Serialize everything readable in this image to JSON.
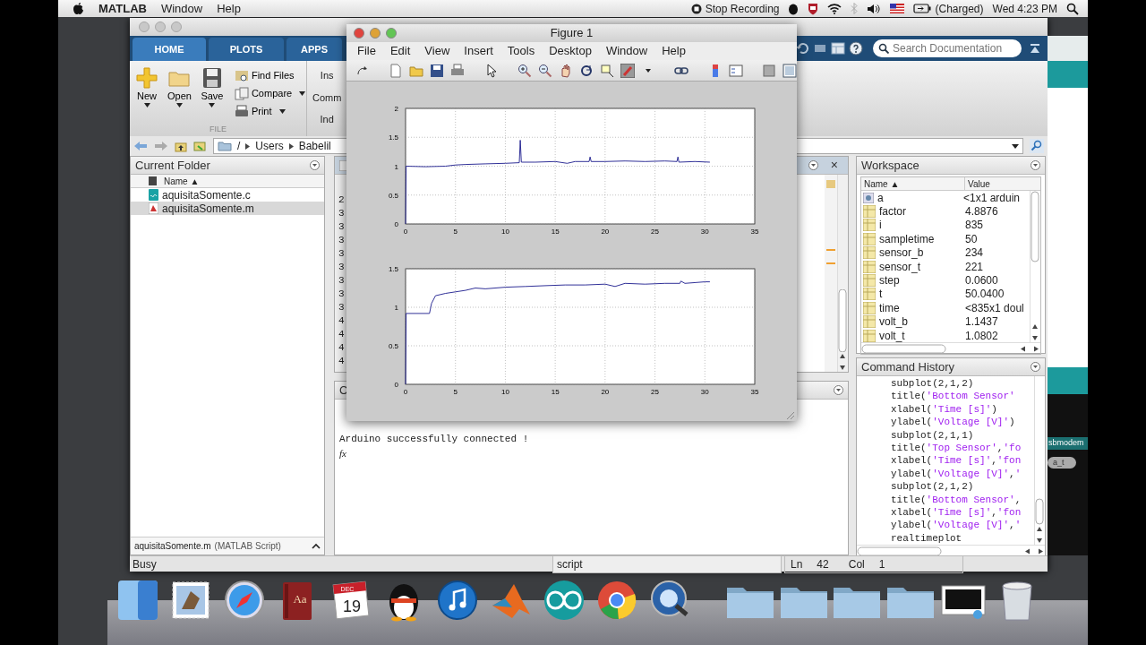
{
  "menubar": {
    "app": "MATLAB",
    "menus": [
      "Window",
      "Help"
    ],
    "recording": "Stop Recording",
    "battery": "(Charged)",
    "clock": "Wed 4:23 PM"
  },
  "matlab": {
    "tabs": [
      {
        "label": "HOME",
        "selected": true
      },
      {
        "label": "PLOTS",
        "selected": false
      },
      {
        "label": "APPS",
        "selected": false
      }
    ],
    "search": {
      "placeholder": "Search Documentation"
    },
    "file_section": {
      "label": "FILE",
      "buttons": [
        {
          "label": "New",
          "kind": "new"
        },
        {
          "label": "Open",
          "kind": "open"
        },
        {
          "label": "Save",
          "kind": "save"
        }
      ],
      "small_buttons": [
        {
          "label": "Find Files",
          "kind": "find",
          "dropdown": false
        },
        {
          "label": "Compare",
          "kind": "compare",
          "dropdown": true
        },
        {
          "label": "Print",
          "kind": "print",
          "dropdown": true
        }
      ]
    },
    "partial_labels": [
      "Ins",
      "Comm",
      "Ind"
    ],
    "path": [
      "/",
      "Users",
      "Babelil"
    ],
    "current_folder": {
      "title": "Current Folder",
      "column": "Name ▲",
      "files": [
        {
          "name": "aquisitaSomente.c",
          "kind": "c",
          "selected": false
        },
        {
          "name": "aquisitaSomente.m",
          "kind": "m",
          "selected": true
        }
      ],
      "details_name": "aquisitaSomente.m",
      "details_type": "(MATLAB Script)"
    },
    "editor": {
      "close": "×",
      "line_numbers": [
        "2",
        "3",
        "3",
        "3",
        "3",
        "3",
        "3",
        "3",
        "3",
        "4",
        "4",
        "4",
        "4"
      ]
    },
    "command_window": {
      "title": "C",
      "output": "Arduino successfully connected !",
      "prompt": "fx"
    },
    "workspace": {
      "title": "Workspace",
      "columns": [
        "Name ▲",
        "Value"
      ],
      "rows": [
        {
          "name": "a",
          "value": "<1x1 arduin",
          "kind": "object"
        },
        {
          "name": "factor",
          "value": "4.8876",
          "kind": "numeric"
        },
        {
          "name": "i",
          "value": "835",
          "kind": "numeric"
        },
        {
          "name": "sampletime",
          "value": "50",
          "kind": "numeric"
        },
        {
          "name": "sensor_b",
          "value": "234",
          "kind": "numeric"
        },
        {
          "name": "sensor_t",
          "value": "221",
          "kind": "numeric"
        },
        {
          "name": "step",
          "value": "0.0600",
          "kind": "numeric"
        },
        {
          "name": "t",
          "value": "50.0400",
          "kind": "numeric"
        },
        {
          "name": "time",
          "value": "<835x1 doul",
          "kind": "numeric"
        },
        {
          "name": "volt_b",
          "value": "1.1437",
          "kind": "numeric"
        },
        {
          "name": "volt_t",
          "value": "1.0802",
          "kind": "numeric"
        }
      ]
    },
    "command_history": {
      "title": "Command History",
      "lines": [
        "subplot(2,1,2)",
        "title('Bottom Sensor'",
        "xlabel('Time [s]')",
        "ylabel('Voltage [V]')",
        "subplot(2,1,1)",
        "title('Top Sensor','fo",
        "xlabel('Time [s]','fon",
        "ylabel('Voltage [V]','",
        "subplot(2,1,2)",
        "title('Bottom Sensor',",
        "xlabel('Time [s]','fon",
        "ylabel('Voltage [V]','",
        "realtimeplot"
      ]
    },
    "status": {
      "state": "Busy",
      "file_type": "script",
      "ln_label": "Ln",
      "ln": "42",
      "col_label": "Col",
      "col": "1"
    }
  },
  "arduino_window": {
    "port": "sbmodem",
    "chip": "a_t"
  },
  "figure": {
    "title": "Figure 1",
    "menus": [
      "File",
      "Edit",
      "View",
      "Insert",
      "Tools",
      "Desktop",
      "Window",
      "Help"
    ],
    "charts": [
      {
        "chart_data": {
          "type": "line",
          "x": [
            0,
            0.05,
            2,
            4,
            5,
            6,
            8,
            10,
            11.4,
            11.5,
            11.6,
            13,
            15,
            16.2,
            17,
            18.4,
            18.5,
            18.6,
            20,
            22,
            24,
            26,
            27.2,
            27.3,
            27.4,
            29,
            30.5
          ],
          "xlim": [
            0,
            35
          ],
          "ylim": [
            0,
            2
          ],
          "xticks": [
            0,
            5,
            10,
            15,
            20,
            25,
            30,
            35
          ],
          "yticks": [
            0,
            0.5,
            1,
            1.5,
            2
          ],
          "grid": true,
          "series": [
            {
              "color": "#1a1a8c",
              "values": [
                0,
                1.0,
                0.99,
                1.0,
                1.02,
                1.03,
                1.04,
                1.05,
                1.06,
                1.45,
                1.07,
                1.07,
                1.08,
                1.05,
                1.08,
                1.08,
                1.16,
                1.08,
                1.08,
                1.09,
                1.08,
                1.09,
                1.08,
                1.16,
                1.07,
                1.08,
                1.07
              ]
            }
          ]
        }
      },
      {
        "chart_data": {
          "type": "line",
          "x": [
            0,
            0.05,
            2.4,
            2.6,
            3,
            4,
            5,
            6,
            7,
            8,
            10,
            12,
            14,
            16,
            18,
            20,
            21,
            22,
            24,
            26,
            27.5,
            27.6,
            28,
            30,
            30.5
          ],
          "xlim": [
            0,
            35
          ],
          "ylim": [
            0,
            1.5
          ],
          "xticks": [
            0,
            5,
            10,
            15,
            20,
            25,
            30,
            35
          ],
          "yticks": [
            0,
            0.5,
            1,
            1.5
          ],
          "grid": true,
          "series": [
            {
              "color": "#1a1a8c",
              "values": [
                0,
                0.92,
                0.92,
                1.05,
                1.15,
                1.18,
                1.2,
                1.22,
                1.25,
                1.24,
                1.26,
                1.27,
                1.28,
                1.29,
                1.29,
                1.3,
                1.27,
                1.31,
                1.3,
                1.31,
                1.31,
                1.34,
                1.31,
                1.33,
                1.33
              ]
            }
          ]
        }
      }
    ]
  },
  "dock": {
    "items": [
      {
        "kind": "finder"
      },
      {
        "kind": "mail"
      },
      {
        "kind": "safari"
      },
      {
        "kind": "dictionary",
        "label": "Aa"
      },
      {
        "kind": "calendar",
        "month": "DEC",
        "day": "19"
      },
      {
        "kind": "penguin"
      },
      {
        "kind": "itunes"
      },
      {
        "kind": "matlab"
      },
      {
        "kind": "arduino"
      },
      {
        "kind": "chrome"
      },
      {
        "kind": "quicktime"
      },
      {
        "kind": "separator"
      },
      {
        "kind": "folder"
      },
      {
        "kind": "folder"
      },
      {
        "kind": "folder"
      },
      {
        "kind": "folder"
      },
      {
        "kind": "monitor"
      },
      {
        "kind": "trash"
      }
    ]
  }
}
